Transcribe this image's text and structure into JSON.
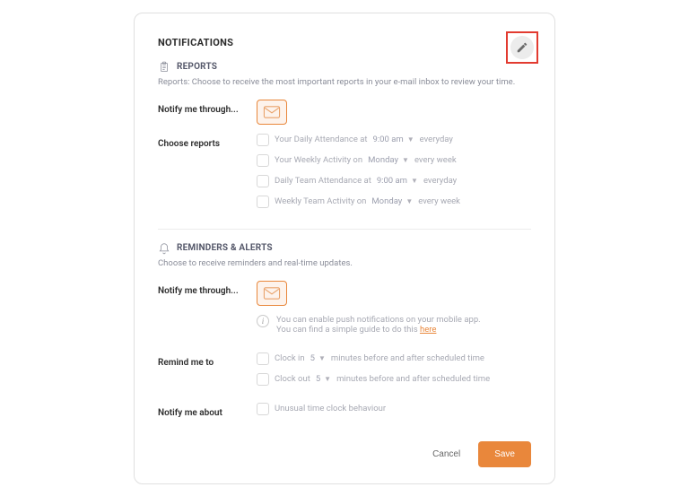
{
  "title": "NOTIFICATIONS",
  "reports": {
    "heading": "REPORTS",
    "desc": "Reports: Choose to receive the most important reports in your e-mail inbox to review your time.",
    "notify_label": "Notify me through...",
    "choose_label": "Choose reports",
    "items": [
      {
        "pre": "Your Daily Attendance at",
        "val": "9:00 am",
        "post": "everyday"
      },
      {
        "pre": "Your Weekly Activity on",
        "val": "Monday",
        "post": "every week"
      },
      {
        "pre": "Daily Team Attendance at",
        "val": "9:00 am",
        "post": "everyday"
      },
      {
        "pre": "Weekly Team Activity on",
        "val": "Monday",
        "post": "every week"
      }
    ]
  },
  "reminders": {
    "heading": "REMINDERS & ALERTS",
    "desc": "Choose to receive reminders and real-time updates.",
    "notify_label": "Notify me through...",
    "info1": "You can enable push notifications on your mobile app.",
    "info2_pre": "You can find a simple guide to do this ",
    "info2_link": "here",
    "remind_label": "Remind me to",
    "remind_items": [
      {
        "pre": "Clock in",
        "val": "5",
        "post": "minutes before and after scheduled time"
      },
      {
        "pre": "Clock out",
        "val": "5",
        "post": "minutes before and after scheduled time"
      }
    ],
    "about_label": "Notify me about",
    "about_item": "Unusual time clock behaviour"
  },
  "actions": {
    "cancel": "Cancel",
    "save": "Save"
  }
}
